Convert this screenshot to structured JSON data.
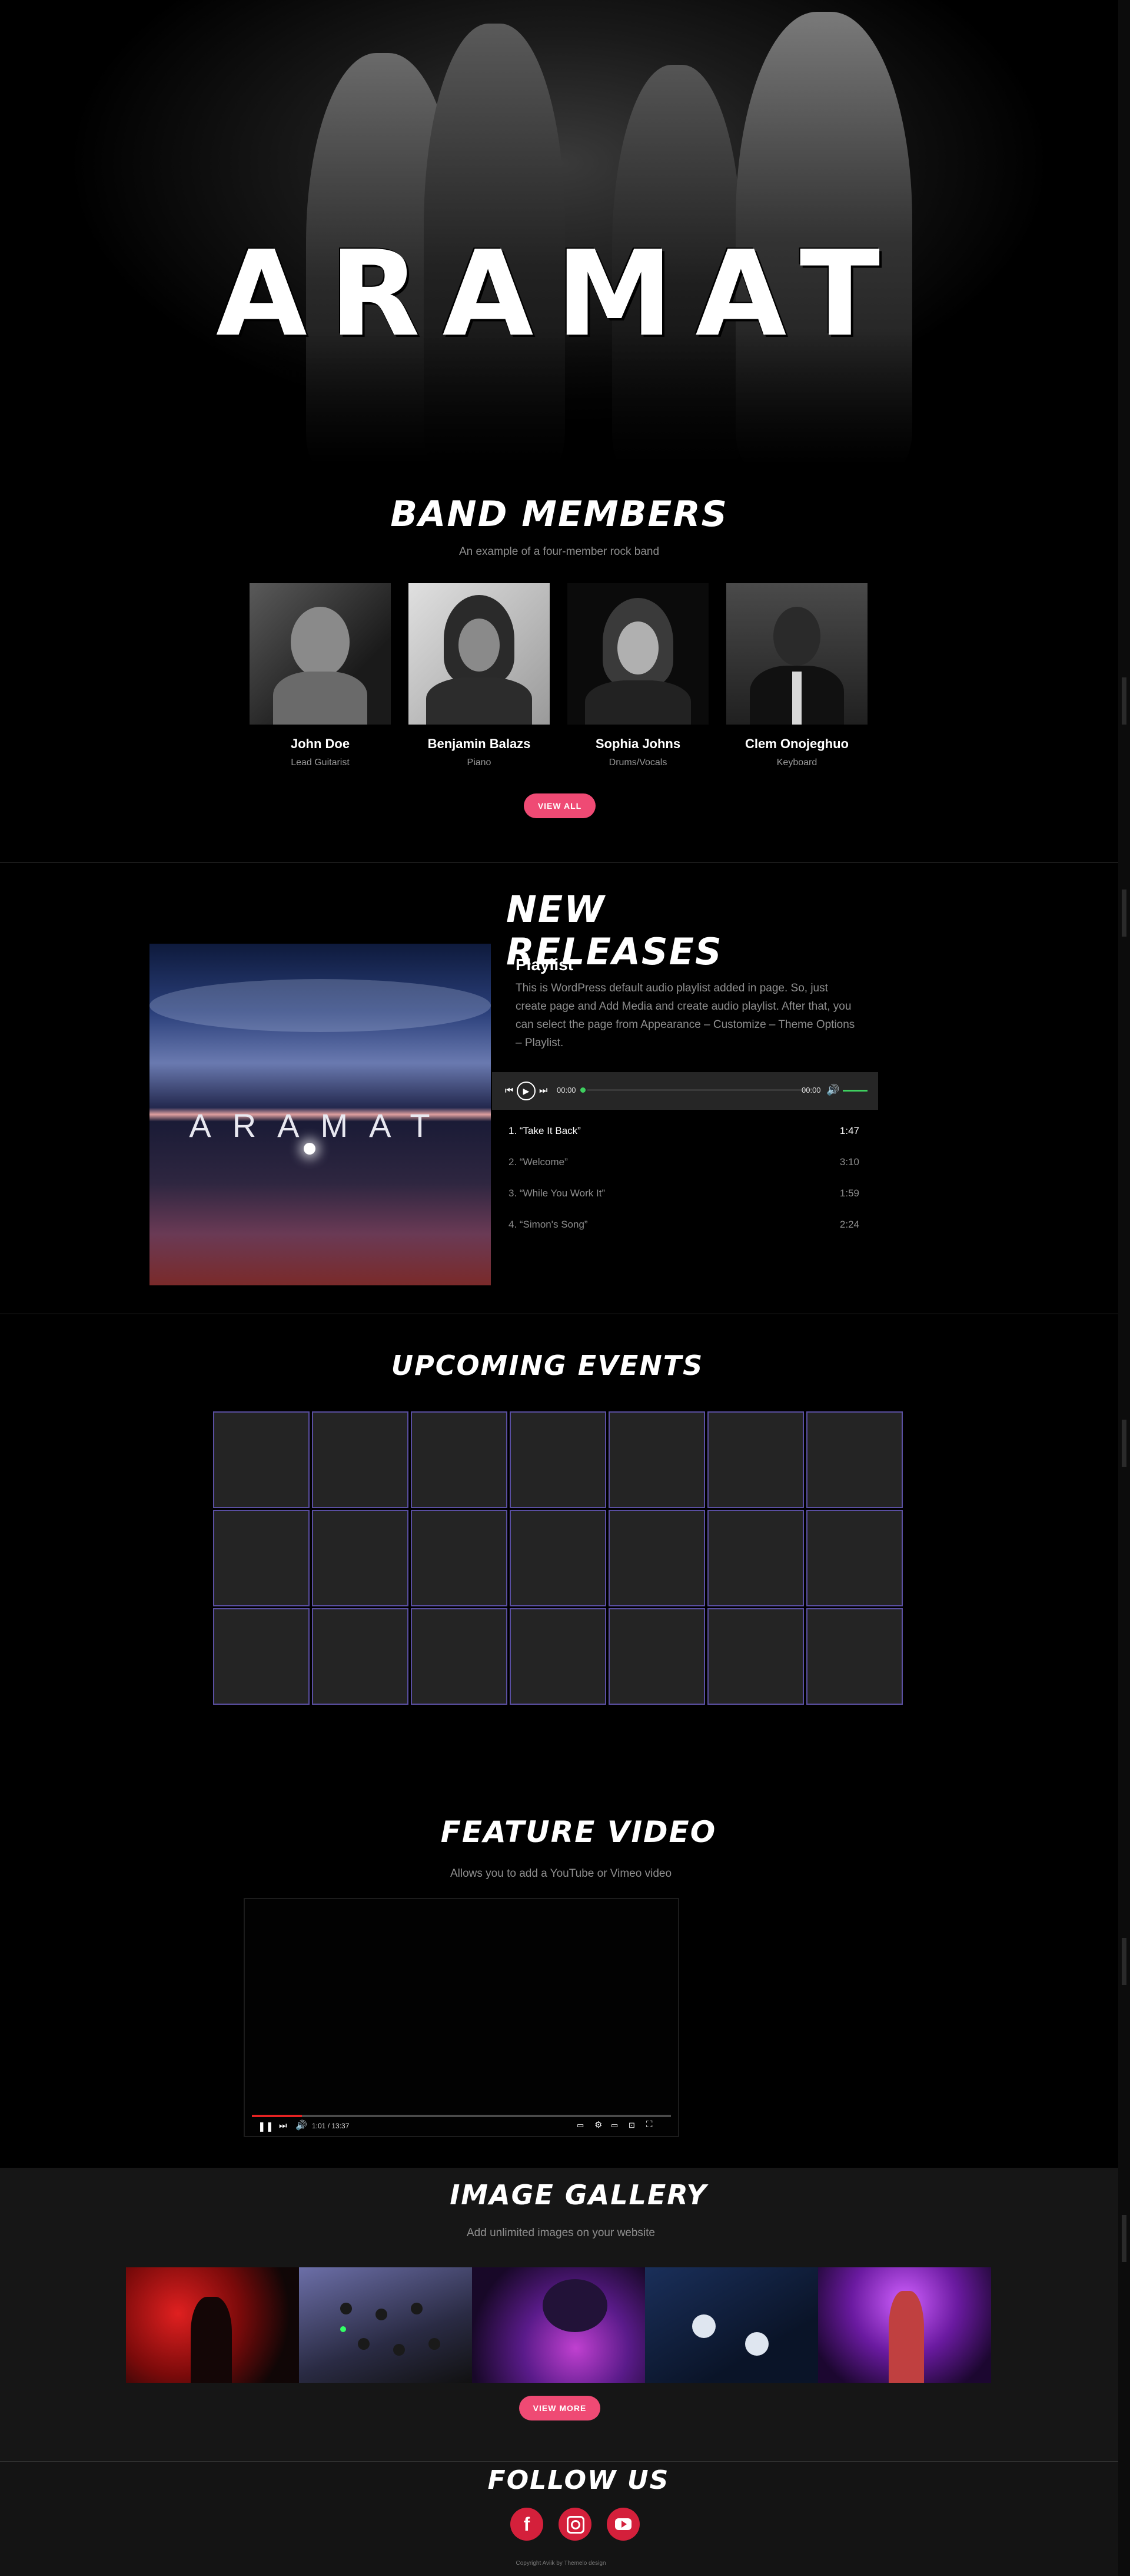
{
  "hero": {
    "title": "ARAMAT"
  },
  "band": {
    "heading": "Band Members",
    "subtitle": "An example of a four-member rock band",
    "members": [
      {
        "name": "John Doe",
        "role": "Lead Guitarist"
      },
      {
        "name": "Benjamin Balazs",
        "role": "Piano"
      },
      {
        "name": "Sophia Johns",
        "role": "Drums/Vocals"
      },
      {
        "name": "Clem Onojeghuo",
        "role": "Keyboard"
      }
    ],
    "view_all": "VIEW ALL"
  },
  "releases": {
    "heading": "New Releases",
    "album_text": "ARAMAT",
    "playlist_title": "Playlist",
    "playlist_desc": "This is WordPress default audio playlist added in page. So, just create page and Add Media and create audio playlist. After that, you can select the page from Appearance – Customize – Theme Options – Playlist.",
    "player": {
      "current": "00:00",
      "total": "00:00"
    },
    "tracks": [
      {
        "title": "1. “Take It Back”",
        "duration": "1:47"
      },
      {
        "title": "2. “Welcome”",
        "duration": "3:10"
      },
      {
        "title": "3. “While You Work It”",
        "duration": "1:59"
      },
      {
        "title": "4. “Simon's Song”",
        "duration": "2:24"
      }
    ]
  },
  "events": {
    "heading": "Upcoming Events"
  },
  "video": {
    "heading": "Feature Video",
    "subtitle": "Allows you to add a YouTube or Vimeo video",
    "time": "1:01 / 13:37",
    "progress": 0.12
  },
  "gallery": {
    "heading": "Image Gallery",
    "subtitle": "Add unlimited images on your website",
    "view_more": "VIEW MORE"
  },
  "follow": {
    "heading": "Follow Us",
    "icons": [
      "facebook-icon",
      "instagram-icon",
      "youtube-icon"
    ],
    "copyright": "Copyright Aviik by Themelo design"
  },
  "colors": {
    "accent": "#ef4a74",
    "social": "#d4203b",
    "calendar_border": "#5a4fa2",
    "volume": "#3ecf5f"
  }
}
